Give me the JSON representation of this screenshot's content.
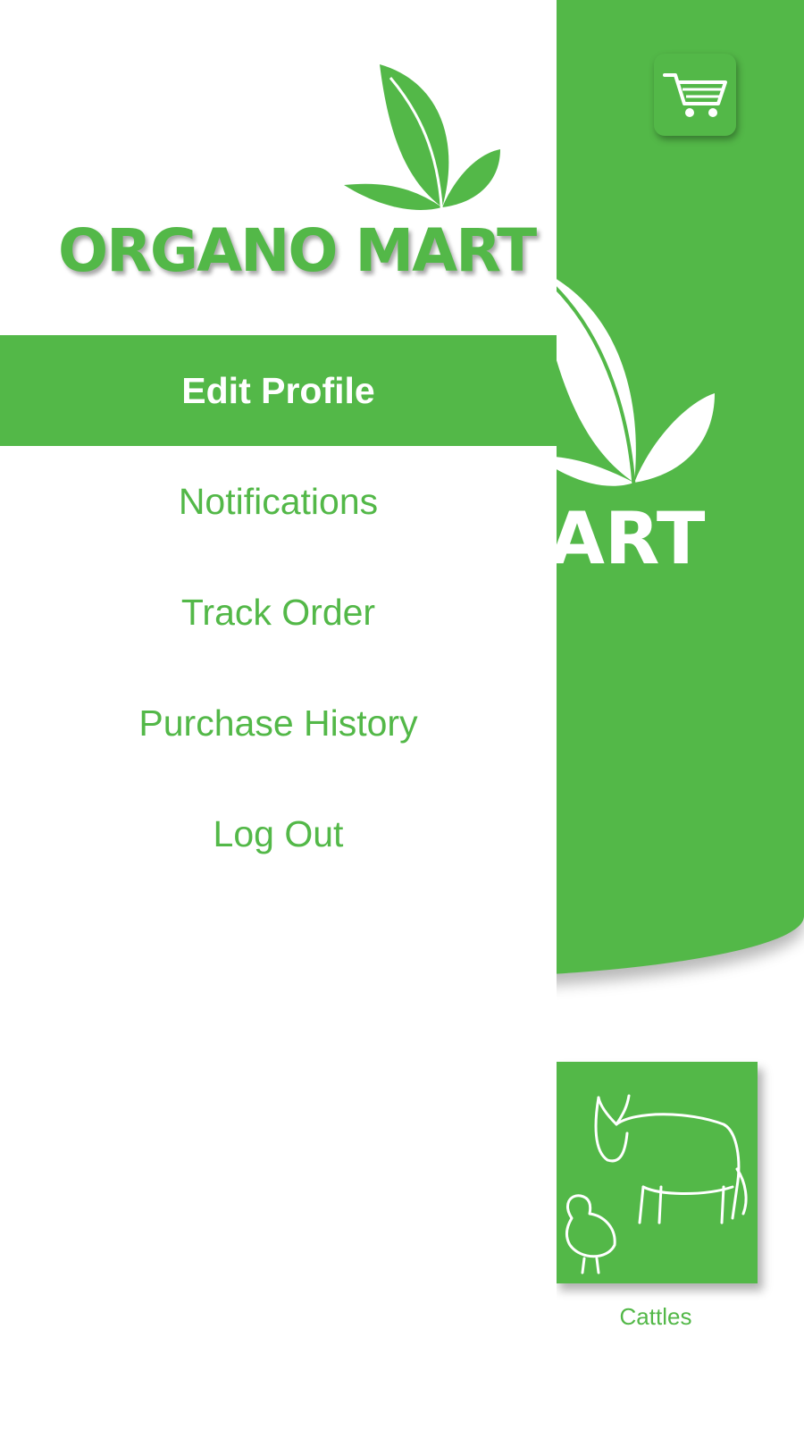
{
  "app": {
    "category": {
      "label": "Cattles",
      "icon": "cow-and-hen-icon"
    },
    "cart_icon": "cart-icon",
    "hero_logo_text": "ART",
    "colors": {
      "brand_green": "#53b848",
      "white": "#ffffff"
    }
  },
  "drawer": {
    "brand_name": "ORGANO MART",
    "menu": [
      {
        "label": "Edit Profile",
        "active": true
      },
      {
        "label": "Notifications",
        "active": false
      },
      {
        "label": "Track Order",
        "active": false
      },
      {
        "label": "Purchase History",
        "active": false
      },
      {
        "label": "Log Out",
        "active": false
      }
    ]
  }
}
